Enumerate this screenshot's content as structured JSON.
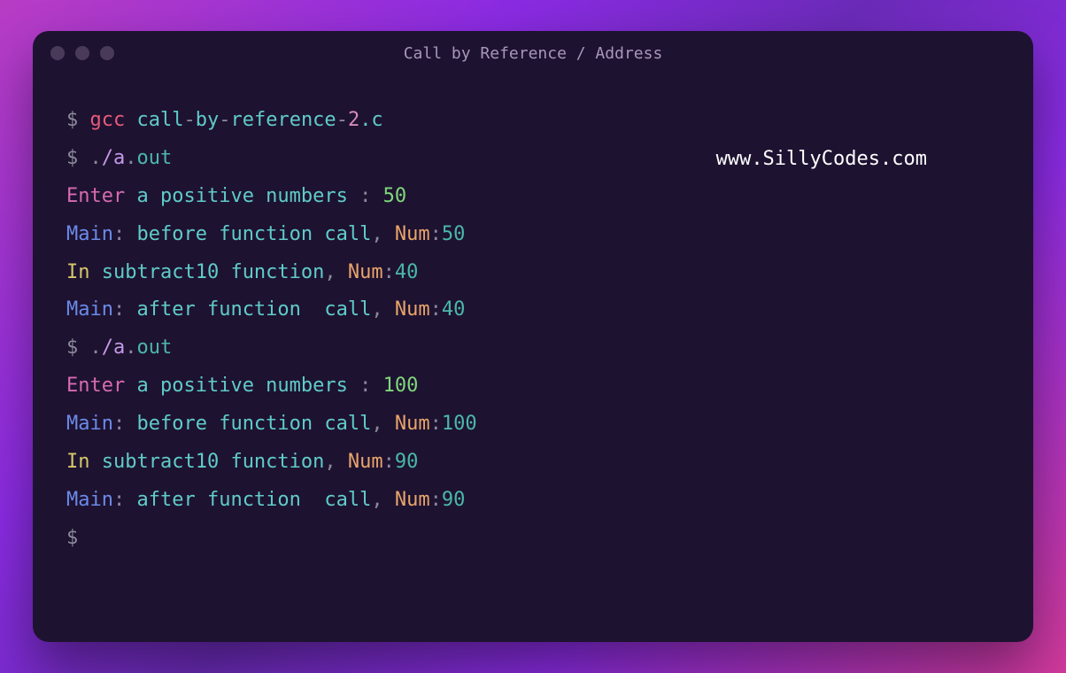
{
  "window": {
    "title": "Call by Reference / Address"
  },
  "watermark": "www.SillyCodes.com",
  "terminal": {
    "prompt": "$",
    "lines": {
      "l1": {
        "prompt": "$ ",
        "cmd": "gcc ",
        "p1": "call",
        "d1": "-",
        "p2": "by",
        "d2": "-",
        "p3": "reference",
        "d3": "-",
        "p4": "2",
        "p5": ".c"
      },
      "l2": {
        "prompt": "$ ",
        "p1": ".",
        "p2": "/a",
        "p3": ".",
        "p4": "out"
      },
      "l3": {
        "p1": "Enter ",
        "p2": "a positive numbers ",
        "p3": ": ",
        "p4": "50"
      },
      "l4": {
        "p1": "Main",
        "p2": ": ",
        "p3": "before function call",
        "p4": ", ",
        "p5": "Num",
        "p6": ":",
        "p7": "50"
      },
      "l5": {
        "p1": "In ",
        "p2": "subtract10 function",
        "p3": ", ",
        "p4": "Num",
        "p5": ":",
        "p6": "40"
      },
      "l6": {
        "p1": "Main",
        "p2": ": ",
        "p3": "after function  call",
        "p4": ", ",
        "p5": "Num",
        "p6": ":",
        "p7": "40"
      },
      "l7": {
        "prompt": "$ ",
        "p1": ".",
        "p2": "/a",
        "p3": ".",
        "p4": "out"
      },
      "l8": {
        "p1": "Enter ",
        "p2": "a positive numbers ",
        "p3": ": ",
        "p4": "100"
      },
      "l9": {
        "p1": "Main",
        "p2": ": ",
        "p3": "before function call",
        "p4": ", ",
        "p5": "Num",
        "p6": ":",
        "p7": "100"
      },
      "l10": {
        "p1": "In ",
        "p2": "subtract10 function",
        "p3": ", ",
        "p4": "Num",
        "p5": ":",
        "p6": "90"
      },
      "l11": {
        "p1": "Main",
        "p2": ": ",
        "p3": "after function  call",
        "p4": ", ",
        "p5": "Num",
        "p6": ":",
        "p7": "90"
      },
      "l12": {
        "prompt": "$"
      }
    }
  }
}
